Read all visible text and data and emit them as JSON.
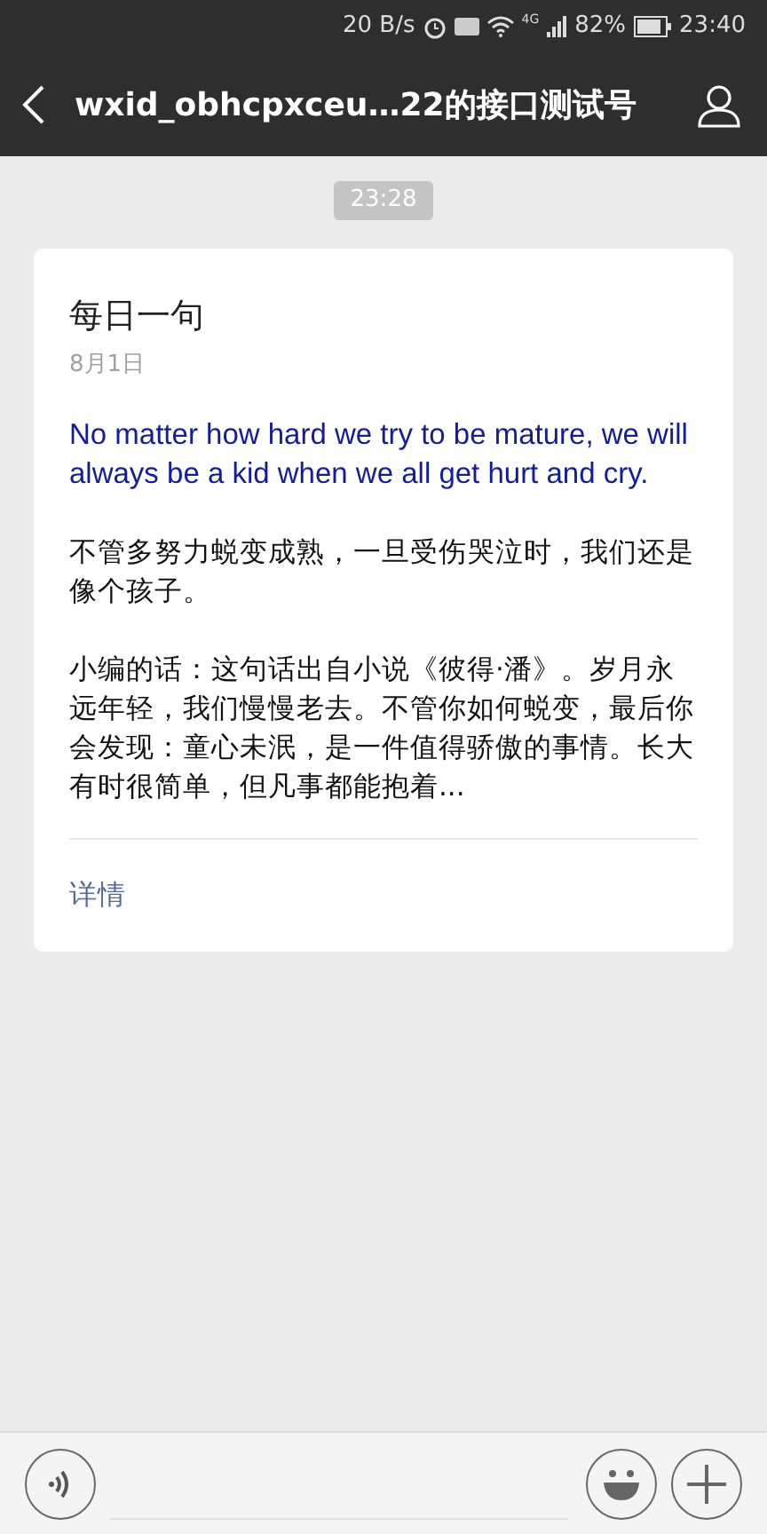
{
  "status_bar": {
    "speed": "20 B/s",
    "network": "4G",
    "battery": "82%",
    "time": "23:40"
  },
  "header": {
    "title": "wxid_obhcpxceu…22的接口测试号"
  },
  "timestamp": "23:28",
  "article": {
    "title": "每日一句",
    "date": "8月1日",
    "quote": "No matter how hard we try to be mature, we will always be a kid when we all get hurt and cry.",
    "paragraphs": [
      "不管多努力蜕变成熟，一旦受伤哭泣时，我们还是像个孩子。",
      "小编的话：这句话出自小说《彼得·潘》。岁月永远年轻，我们慢慢老去。不管你如何蜕变，最后你会发现：童心未泯，是一件值得骄傲的事情。长大有时很简单，但凡事都能抱着..."
    ],
    "link": "详情"
  }
}
